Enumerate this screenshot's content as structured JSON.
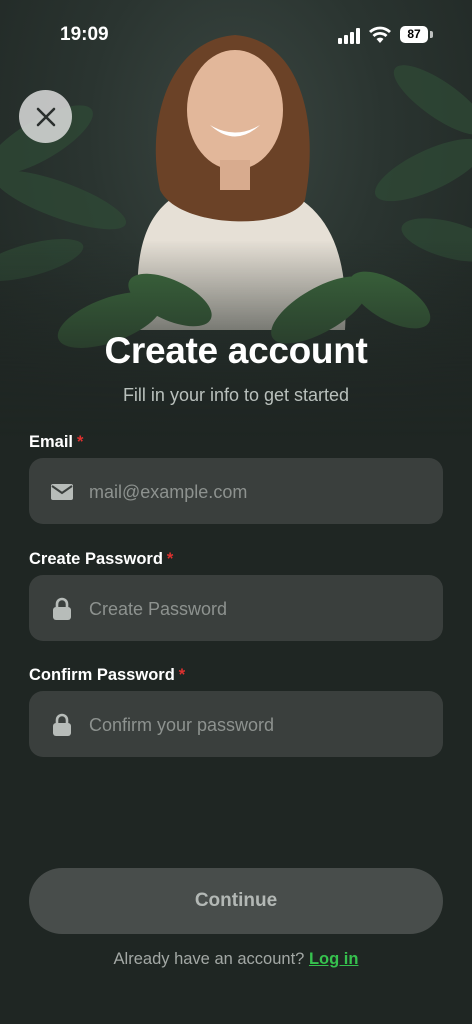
{
  "status_bar": {
    "time": "19:09",
    "battery": "87"
  },
  "header": {
    "title": "Create account",
    "subtitle": "Fill in your info to get started"
  },
  "form": {
    "email": {
      "label": "Email",
      "required_mark": "*",
      "placeholder": "mail@example.com",
      "value": ""
    },
    "create_password": {
      "label": "Create Password",
      "required_mark": "*",
      "placeholder": "Create Password",
      "value": ""
    },
    "confirm_password": {
      "label": "Confirm Password",
      "required_mark": "*",
      "placeholder": "Confirm your password",
      "value": ""
    }
  },
  "actions": {
    "continue_label": "Continue"
  },
  "footer": {
    "prompt": "Already have an account?",
    "login_label": "Log in"
  },
  "colors": {
    "background": "#1f2623",
    "field": "#3a3f3d",
    "required": "#e0312f",
    "link": "#36c14e",
    "button": "#484d4b"
  },
  "icons": {
    "close": "close-icon",
    "email": "envelope-icon",
    "password": "lock-icon"
  }
}
